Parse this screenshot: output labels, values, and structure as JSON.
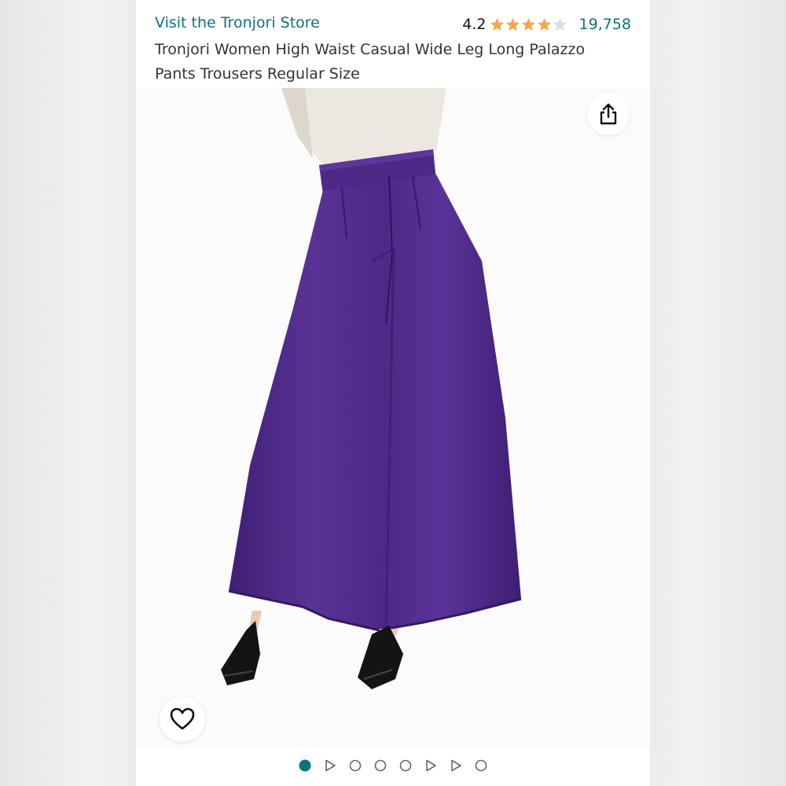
{
  "header": {
    "store_link": "Visit the Tronjori Store",
    "rating": "4.2",
    "rating_fraction": 0.84,
    "rating_count": "19,758",
    "title": "Tronjori Women High Waist Casual Wide Leg Long Palazzo Pants Trousers Regular Size"
  },
  "stars": [
    "full",
    "full",
    "full",
    "full",
    "empty"
  ],
  "icons": {
    "share": "share-icon",
    "wishlist": "heart-icon"
  },
  "carousel": {
    "items": [
      "image",
      "video",
      "image",
      "image",
      "image",
      "video",
      "video",
      "image"
    ],
    "active_index": 0
  },
  "colors": {
    "link": "#0f7080",
    "star": "#f3a847",
    "star_empty": "#dddddd",
    "pants": "#4f2a8c",
    "dot_active": "#0f7080"
  }
}
